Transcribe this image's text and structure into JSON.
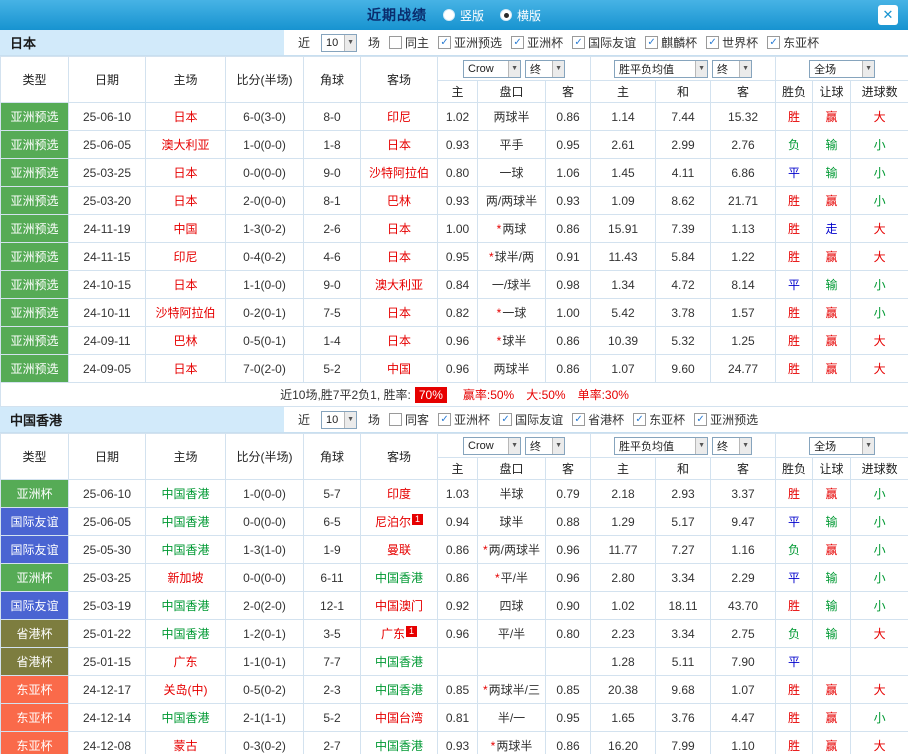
{
  "titlebar": {
    "title": "近期战绩",
    "radios": [
      {
        "label": "竖版",
        "selected": false
      },
      {
        "label": "横版",
        "selected": true
      }
    ],
    "close_label": "✕"
  },
  "icons": {
    "check": "✓",
    "arrow_down": "▼",
    "star": "*"
  },
  "filter_prefix": {
    "near": "近",
    "count": "10",
    "games": "场"
  },
  "table_header": {
    "cols": [
      "类型",
      "日期",
      "主场",
      "比分(半场)",
      "角球",
      "客场"
    ],
    "odds_dd": "Crow",
    "final_dd": "终",
    "avg_dd": "胜平负均值",
    "avg_final_dd": "终",
    "scope_dd": "全场",
    "sub_cols": [
      "主",
      "盘口",
      "客",
      "主",
      "和",
      "客",
      "胜负",
      "让球",
      "进球数"
    ]
  },
  "type_colors": {
    "亚洲预选": "#56ab56",
    "亚洲杯": "#56ab56",
    "国际友谊": "#4a64d2",
    "省港杯": "#7d7d3f",
    "东亚杯": "#fa6a4a"
  },
  "result_colors": {
    "胜": "#e60000",
    "赢": "#e60000",
    "大": "#e60000",
    "负": "#009933",
    "输": "#009933",
    "小": "#009933",
    "平": "#0000cc",
    "走": "#0000cc"
  },
  "sections": [
    {
      "team": "日本",
      "team_color": "#e60000",
      "opponent_color": "#e60000",
      "filters": [
        {
          "label": "同主",
          "checked": false
        },
        {
          "label": "亚洲预选",
          "checked": true
        },
        {
          "label": "亚洲杯",
          "checked": true
        },
        {
          "label": "国际友谊",
          "checked": true
        },
        {
          "label": "麒麟杯",
          "checked": true
        },
        {
          "label": "世界杯",
          "checked": true
        },
        {
          "label": "东亚杯",
          "checked": true
        }
      ],
      "rows": [
        {
          "type": "亚洲预选",
          "date": "25-06-10",
          "home": "日本",
          "score": "6-0(3-0)",
          "corner": "8-0",
          "away": "印尼",
          "o1": "1.02",
          "star": false,
          "hc": "两球半",
          "o2": "0.86",
          "m1": "1.14",
          "m2": "7.44",
          "m3": "15.32",
          "res": "胜",
          "hcres": "赢",
          "goal": "大"
        },
        {
          "type": "亚洲预选",
          "date": "25-06-05",
          "home": "澳大利亚",
          "score": "1-0(0-0)",
          "corner": "1-8",
          "away": "日本",
          "o1": "0.93",
          "star": false,
          "hc": "平手",
          "o2": "0.95",
          "m1": "2.61",
          "m2": "2.99",
          "m3": "2.76",
          "res": "负",
          "hcres": "输",
          "goal": "小"
        },
        {
          "type": "亚洲预选",
          "date": "25-03-25",
          "home": "日本",
          "score": "0-0(0-0)",
          "corner": "9-0",
          "away": "沙特阿拉伯",
          "o1": "0.80",
          "star": false,
          "hc": "一球",
          "o2": "1.06",
          "m1": "1.45",
          "m2": "4.11",
          "m3": "6.86",
          "res": "平",
          "hcres": "输",
          "goal": "小"
        },
        {
          "type": "亚洲预选",
          "date": "25-03-20",
          "home": "日本",
          "score": "2-0(0-0)",
          "corner": "8-1",
          "away": "巴林",
          "o1": "0.93",
          "star": false,
          "hc": "两/两球半",
          "o2": "0.93",
          "m1": "1.09",
          "m2": "8.62",
          "m3": "21.71",
          "res": "胜",
          "hcres": "赢",
          "goal": "小"
        },
        {
          "type": "亚洲预选",
          "date": "24-11-19",
          "home": "中国",
          "score": "1-3(0-2)",
          "corner": "2-6",
          "away": "日本",
          "o1": "1.00",
          "star": true,
          "hc": "两球",
          "o2": "0.86",
          "m1": "15.91",
          "m2": "7.39",
          "m3": "1.13",
          "res": "胜",
          "hcres": "走",
          "goal": "大"
        },
        {
          "type": "亚洲预选",
          "date": "24-11-15",
          "home": "印尼",
          "score": "0-4(0-2)",
          "corner": "4-6",
          "away": "日本",
          "o1": "0.95",
          "star": true,
          "hc": "球半/两",
          "o2": "0.91",
          "m1": "11.43",
          "m2": "5.84",
          "m3": "1.22",
          "res": "胜",
          "hcres": "赢",
          "goal": "大"
        },
        {
          "type": "亚洲预选",
          "date": "24-10-15",
          "home": "日本",
          "score": "1-1(0-0)",
          "corner": "9-0",
          "away": "澳大利亚",
          "o1": "0.84",
          "star": false,
          "hc": "一/球半",
          "o2": "0.98",
          "m1": "1.34",
          "m2": "4.72",
          "m3": "8.14",
          "res": "平",
          "hcres": "输",
          "goal": "小"
        },
        {
          "type": "亚洲预选",
          "date": "24-10-11",
          "home": "沙特阿拉伯",
          "score": "0-2(0-1)",
          "corner": "7-5",
          "away": "日本",
          "o1": "0.82",
          "star": true,
          "hc": "一球",
          "o2": "1.00",
          "m1": "5.42",
          "m2": "3.78",
          "m3": "1.57",
          "res": "胜",
          "hcres": "赢",
          "goal": "小"
        },
        {
          "type": "亚洲预选",
          "date": "24-09-11",
          "home": "巴林",
          "score": "0-5(0-1)",
          "corner": "1-4",
          "away": "日本",
          "o1": "0.96",
          "star": true,
          "hc": "球半",
          "o2": "0.86",
          "m1": "10.39",
          "m2": "5.32",
          "m3": "1.25",
          "res": "胜",
          "hcres": "赢",
          "goal": "大"
        },
        {
          "type": "亚洲预选",
          "date": "24-09-05",
          "home": "日本",
          "score": "7-0(2-0)",
          "corner": "5-2",
          "away": "中国",
          "o1": "0.96",
          "star": false,
          "hc": "两球半",
          "o2": "0.86",
          "m1": "1.07",
          "m2": "9.60",
          "m3": "24.77",
          "res": "胜",
          "hcres": "赢",
          "goal": "大"
        }
      ],
      "summary": {
        "pre": "近10场,胜7平2负1, 胜率:",
        "badge": "70%",
        "stats": [
          "赢率:50%",
          "大:50%",
          "单率:30%"
        ]
      }
    },
    {
      "team": "中国香港",
      "team_color": "#009933",
      "opponent_color": "#e60000",
      "filters": [
        {
          "label": "同客",
          "checked": false
        },
        {
          "label": "亚洲杯",
          "checked": true
        },
        {
          "label": "国际友谊",
          "checked": true
        },
        {
          "label": "省港杯",
          "checked": true
        },
        {
          "label": "东亚杯",
          "checked": true
        },
        {
          "label": "亚洲预选",
          "checked": true
        }
      ],
      "rows": [
        {
          "type": "亚洲杯",
          "date": "25-06-10",
          "home": "中国香港",
          "score": "1-0(0-0)",
          "corner": "5-7",
          "away": "印度",
          "o1": "1.03",
          "star": false,
          "hc": "半球",
          "o2": "0.79",
          "m1": "2.18",
          "m2": "2.93",
          "m3": "3.37",
          "res": "胜",
          "hcres": "赢",
          "goal": "小"
        },
        {
          "type": "国际友谊",
          "date": "25-06-05",
          "home": "中国香港",
          "score": "0-0(0-0)",
          "corner": "6-5",
          "away": "尼泊尔",
          "away_sup": "1",
          "o1": "0.94",
          "star": false,
          "hc": "球半",
          "o2": "0.88",
          "m1": "1.29",
          "m2": "5.17",
          "m3": "9.47",
          "res": "平",
          "hcres": "输",
          "goal": "小"
        },
        {
          "type": "国际友谊",
          "date": "25-05-30",
          "home": "中国香港",
          "score": "1-3(1-0)",
          "corner": "1-9",
          "away": "曼联",
          "o1": "0.86",
          "star": true,
          "hc": "两/两球半",
          "o2": "0.96",
          "m1": "11.77",
          "m2": "7.27",
          "m3": "1.16",
          "res": "负",
          "hcres": "赢",
          "goal": "小"
        },
        {
          "type": "亚洲杯",
          "date": "25-03-25",
          "home": "新加坡",
          "score": "0-0(0-0)",
          "corner": "6-11",
          "away": "中国香港",
          "o1": "0.86",
          "star": true,
          "hc": "平/半",
          "o2": "0.96",
          "m1": "2.80",
          "m2": "3.34",
          "m3": "2.29",
          "res": "平",
          "hcres": "输",
          "goal": "小"
        },
        {
          "type": "国际友谊",
          "date": "25-03-19",
          "home": "中国香港",
          "score": "2-0(2-0)",
          "corner": "12-1",
          "away": "中国澳门",
          "o1": "0.92",
          "star": false,
          "hc": "四球",
          "o2": "0.90",
          "m1": "1.02",
          "m2": "18.11",
          "m3": "43.70",
          "res": "胜",
          "hcres": "输",
          "goal": "小"
        },
        {
          "type": "省港杯",
          "date": "25-01-22",
          "home": "中国香港",
          "score": "1-2(0-1)",
          "corner": "3-5",
          "away": "广东",
          "away_sup": "1",
          "o1": "0.96",
          "star": false,
          "hc": "平/半",
          "o2": "0.80",
          "m1": "2.23",
          "m2": "3.34",
          "m3": "2.75",
          "res": "负",
          "hcres": "输",
          "goal": "大"
        },
        {
          "type": "省港杯",
          "date": "25-01-15",
          "home": "广东",
          "score": "1-1(0-1)",
          "corner": "7-7",
          "away": "中国香港",
          "o1": "",
          "star": false,
          "hc": "",
          "o2": "",
          "m1": "1.28",
          "m2": "5.11",
          "m3": "7.90",
          "res": "平",
          "hcres": "",
          "goal": ""
        },
        {
          "type": "东亚杯",
          "date": "24-12-17",
          "home": "关岛(中)",
          "score": "0-5(0-2)",
          "corner": "2-3",
          "away": "中国香港",
          "o1": "0.85",
          "star": true,
          "hc": "两球半/三",
          "o2": "0.85",
          "m1": "20.38",
          "m2": "9.68",
          "m3": "1.07",
          "res": "胜",
          "hcres": "赢",
          "goal": "大"
        },
        {
          "type": "东亚杯",
          "date": "24-12-14",
          "home": "中国香港",
          "score": "2-1(1-1)",
          "corner": "5-2",
          "away": "中国台湾",
          "o1": "0.81",
          "star": false,
          "hc": "半/一",
          "o2": "0.95",
          "m1": "1.65",
          "m2": "3.76",
          "m3": "4.47",
          "res": "胜",
          "hcres": "赢",
          "goal": "小"
        },
        {
          "type": "东亚杯",
          "date": "24-12-08",
          "home": "蒙古",
          "score": "0-3(0-2)",
          "corner": "2-7",
          "away": "中国香港",
          "o1": "0.93",
          "star": true,
          "hc": "两球半",
          "o2": "0.86",
          "m1": "16.20",
          "m2": "7.99",
          "m3": "1.10",
          "res": "胜",
          "hcres": "赢",
          "goal": "大"
        }
      ]
    }
  ]
}
